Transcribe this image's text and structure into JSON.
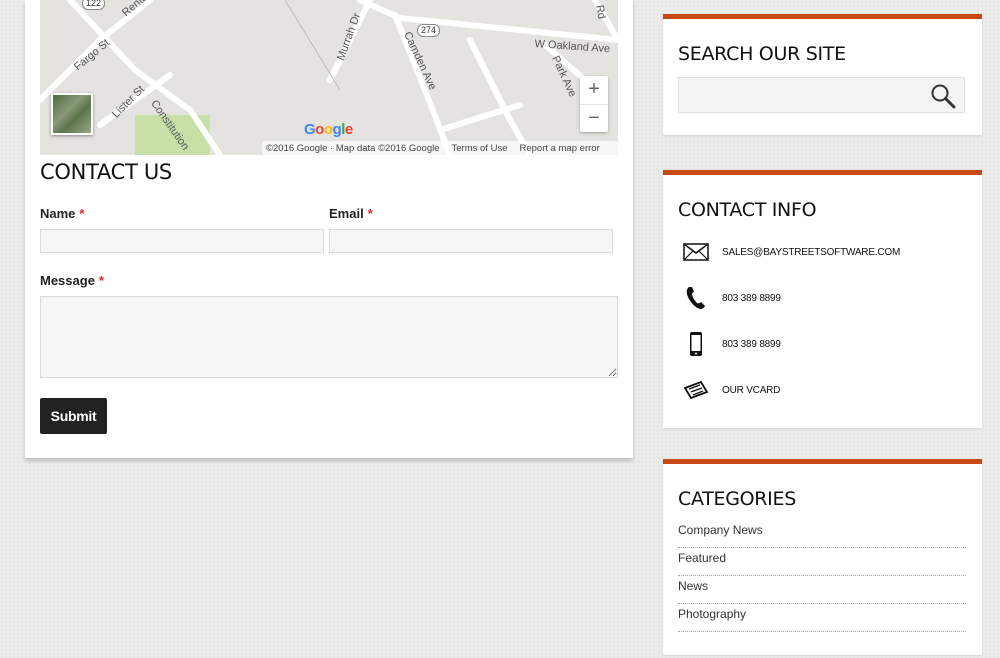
{
  "map": {
    "streets": [
      "Rental",
      "Fargo St",
      "Lister St",
      "Constitution",
      "Murrah Dr",
      "Camden Ave",
      "Park Ave",
      "W Oakland Ave",
      "Rd"
    ],
    "route_shields": [
      "122",
      "274"
    ],
    "zoom_in": "+",
    "zoom_out": "−",
    "logo": "Google",
    "copyright": "©2016 Google · Map data ©2016 Google",
    "terms": "Terms of Use",
    "report": "Report a map error"
  },
  "contact": {
    "title": "CONTACT US",
    "name_label": "Name",
    "email_label": "Email",
    "message_label": "Message",
    "required_mark": "*",
    "submit_label": "Submit"
  },
  "search": {
    "title": "SEARCH OUR SITE",
    "icon": "search-icon"
  },
  "contact_info": {
    "title": "CONTACT INFO",
    "items": [
      {
        "icon": "envelope-icon",
        "text": "SALES@BAYSTREETSOFTWARE.COM"
      },
      {
        "icon": "phone-icon",
        "text": "803 389 8899"
      },
      {
        "icon": "mobile-icon",
        "text": "803 389 8899"
      },
      {
        "icon": "vcard-icon",
        "text": "OUR VCARD"
      }
    ]
  },
  "categories": {
    "title": "CATEGORIES",
    "items": [
      "Company News",
      "Featured",
      "News",
      "Photography"
    ]
  },
  "colors": {
    "accent": "#c84a12",
    "required": "#e0252b",
    "button": "#222222"
  }
}
